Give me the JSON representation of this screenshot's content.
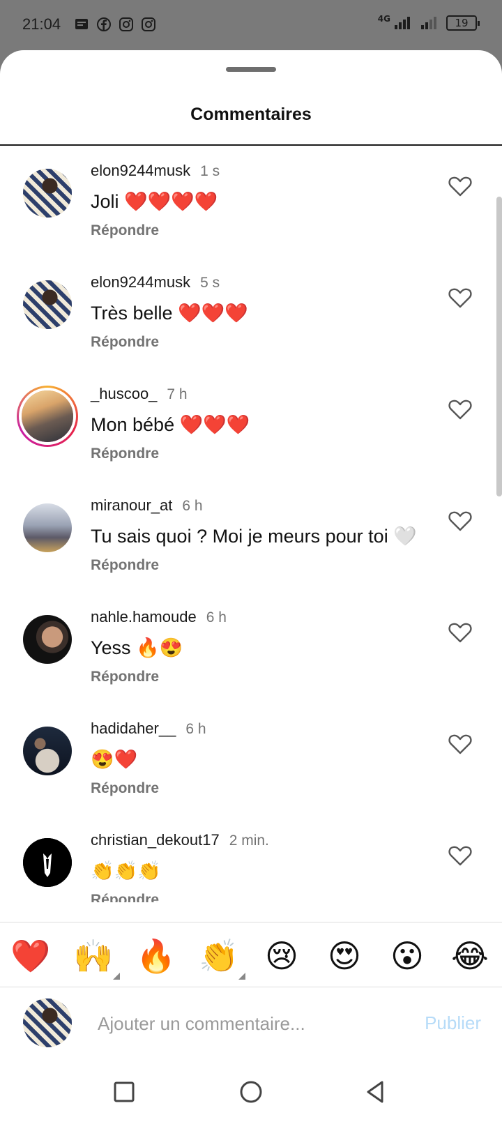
{
  "status": {
    "time": "21:04",
    "network": "4G",
    "battery": "19",
    "notification_icons": [
      "message-icon",
      "facebook-icon",
      "instagram-icon",
      "instagram-icon"
    ]
  },
  "sheet": {
    "title": "Commentaires"
  },
  "comments": [
    {
      "username": "elon9244musk",
      "time": "1 s",
      "text": "Joli ❤️❤️❤️❤️",
      "reply": "Répondre"
    },
    {
      "username": "elon9244musk",
      "time": "5 s",
      "text": "Très belle ❤️❤️❤️",
      "reply": "Répondre"
    },
    {
      "username": "_huscoo_",
      "time": "7 h",
      "text": "Mon bébé ❤️❤️❤️",
      "reply": "Répondre"
    },
    {
      "username": "miranour_at",
      "time": "6 h",
      "text": "Tu sais quoi ? Moi je meurs pour toi 🤍",
      "reply": "Répondre"
    },
    {
      "username": "nahle.hamoude",
      "time": "6 h",
      "text": "Yess 🔥😍",
      "reply": "Répondre"
    },
    {
      "username": "hadidaher__",
      "time": "6 h",
      "text": "😍❤️",
      "reply": "Répondre"
    },
    {
      "username": "christian_dekout17",
      "time": "2 min.",
      "text": "👏👏👏",
      "reply": "Répondre"
    }
  ],
  "quick_reactions": [
    "❤️",
    "🙌",
    "🔥",
    "👏",
    "😢",
    "😍",
    "😮",
    "😂"
  ],
  "composer": {
    "placeholder": "Ajouter un commentaire...",
    "publish": "Publier"
  },
  "colors": {
    "accent_disabled": "#b6dbf8",
    "secondary_text": "#737373"
  }
}
